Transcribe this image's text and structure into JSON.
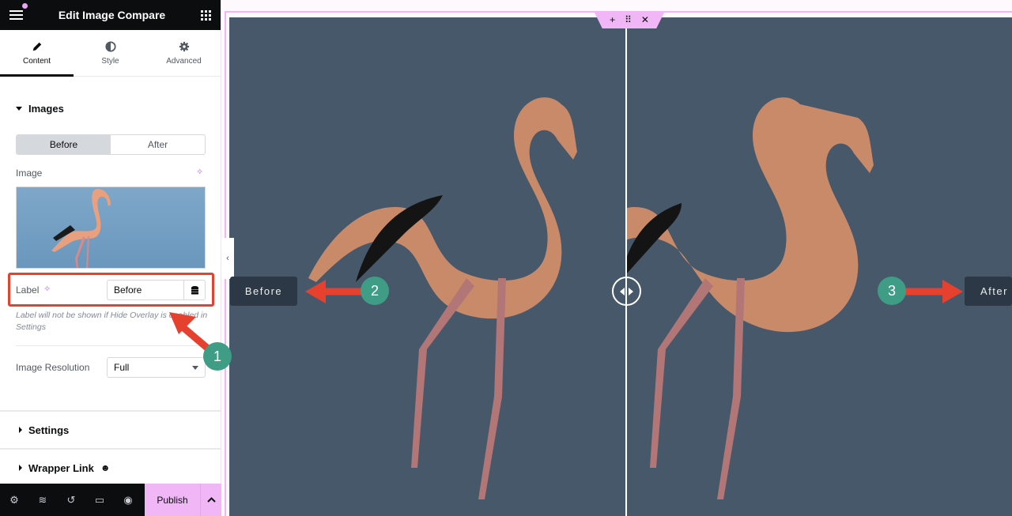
{
  "panel": {
    "title": "Edit Image Compare",
    "tabs": [
      {
        "label": "Content",
        "icon": "pencil-icon",
        "active": true
      },
      {
        "label": "Style",
        "icon": "half-circle-icon",
        "active": false
      },
      {
        "label": "Advanced",
        "icon": "gear-icon",
        "active": false
      }
    ],
    "images_section": {
      "title": "Images",
      "switch": {
        "options": [
          "Before",
          "After"
        ],
        "selected": "Before"
      },
      "image_label": "Image",
      "label_field": {
        "label": "Label",
        "value": "Before"
      },
      "hint": "Label will not be shown if Hide Overlay is enabled in Settings",
      "resolution": {
        "label": "Image Resolution",
        "value": "Full"
      }
    },
    "sections": [
      {
        "title": "Settings"
      },
      {
        "title": "Wrapper Link",
        "badge_icon": "pro-icon"
      }
    ],
    "bottom_bar": {
      "icons": [
        "settings-icon",
        "layers-icon",
        "history-icon",
        "responsive-icon",
        "preview-icon"
      ],
      "publish_label": "Publish"
    }
  },
  "canvas": {
    "before_label": "Before",
    "after_label": "After",
    "divider_position_percent": 50.5,
    "toolbar_icons": [
      "+",
      "⋮⋮",
      "✕"
    ]
  },
  "annotations": {
    "accent_color": "#e6412e",
    "badge_color": "#3f9d85",
    "badges": [
      "1",
      "2",
      "3"
    ]
  }
}
